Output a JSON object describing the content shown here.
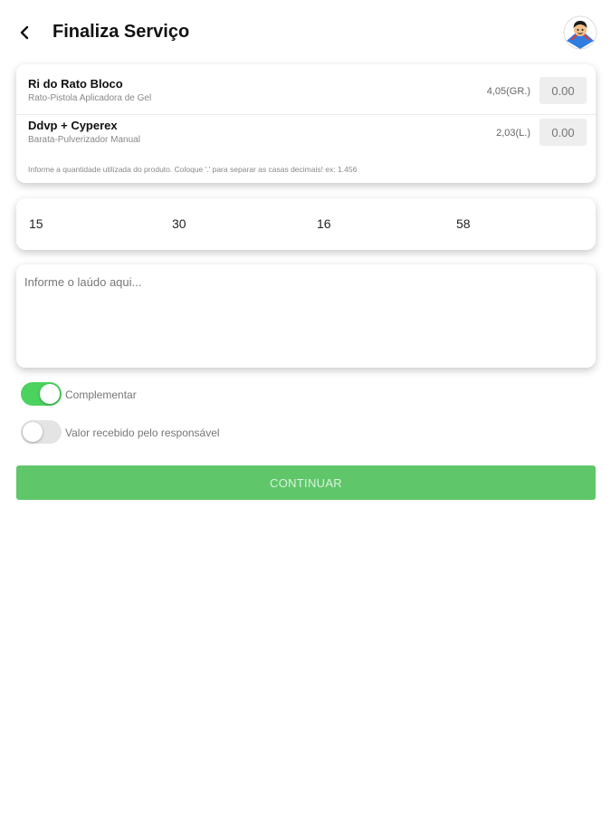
{
  "header": {
    "title": "Finaliza Serviço",
    "back_icon": "chevron-left-icon",
    "avatar_icon": "user-avatar-icon"
  },
  "products": {
    "items": [
      {
        "name": "Ri do Rato Bloco",
        "subtitle": "Rato-Pistola Aplicadora de Gel",
        "quantity": "4,05(GR.)",
        "input_placeholder": "0.00"
      },
      {
        "name": "Ddvp + Cyperex",
        "subtitle": "Barata-Pulverizador Manual",
        "quantity": "2,03(L.)",
        "input_placeholder": "0.00"
      }
    ],
    "hint": "Informe a quantidade utilizada do produto. Coloque '.' para separar as casas decimais! ex: 1.456"
  },
  "numbers": [
    "15",
    "30",
    "16",
    "58"
  ],
  "report": {
    "placeholder": "Informe o laúdo aqui..."
  },
  "toggles": [
    {
      "label": "Complementar",
      "state": "on"
    },
    {
      "label": "Valor recebido pelo responsável",
      "state": "off"
    }
  ],
  "continue_label": "CONTINUAR",
  "colors": {
    "accent": "#4cd35f",
    "button": "#60c66a"
  }
}
